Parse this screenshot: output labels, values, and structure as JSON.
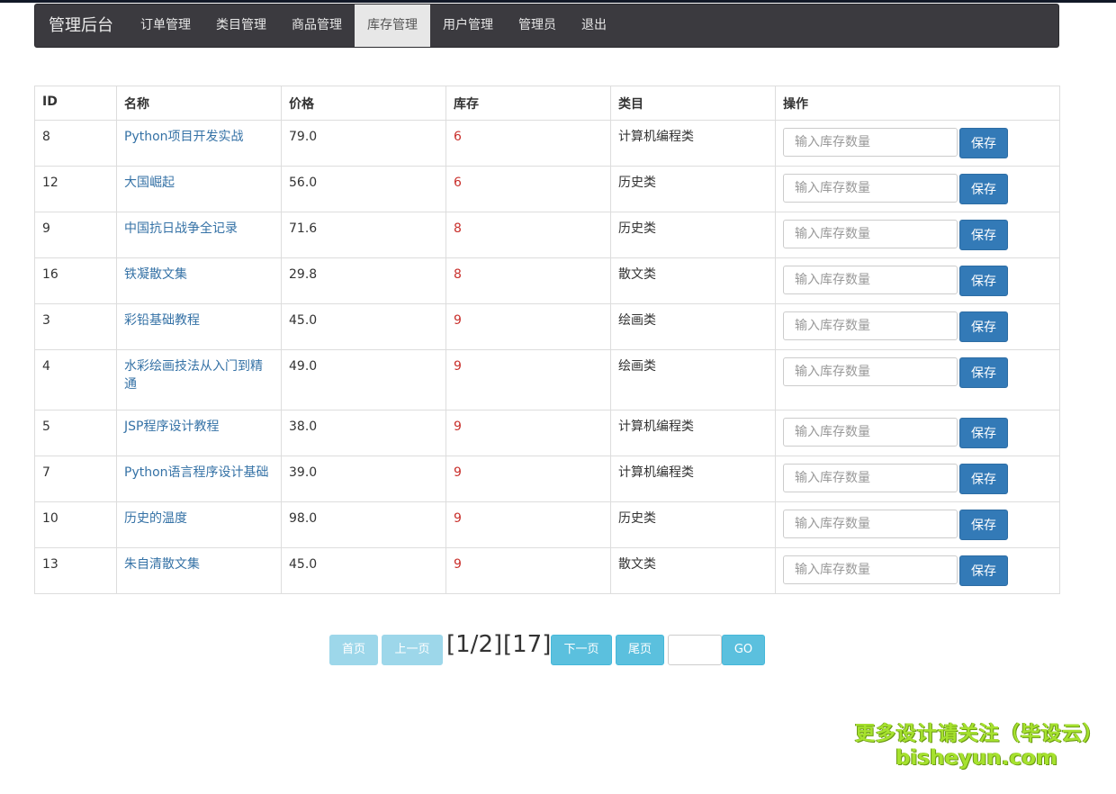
{
  "navbar": {
    "brand": "管理后台",
    "items": [
      {
        "label": "订单管理",
        "active": false
      },
      {
        "label": "类目管理",
        "active": false
      },
      {
        "label": "商品管理",
        "active": false
      },
      {
        "label": "库存管理",
        "active": true
      },
      {
        "label": "用户管理",
        "active": false
      },
      {
        "label": "管理员",
        "active": false
      },
      {
        "label": "退出",
        "active": false
      }
    ]
  },
  "table": {
    "headers": [
      "ID",
      "名称",
      "价格",
      "库存",
      "类目",
      "操作"
    ],
    "input_placeholder": "输入库存数量",
    "save_label": "保存",
    "rows": [
      {
        "id": "8",
        "name": "Python项目开发实战",
        "price": "79.0",
        "stock": "6",
        "category": "计算机编程类"
      },
      {
        "id": "12",
        "name": "大国崛起",
        "price": "56.0",
        "stock": "6",
        "category": "历史类"
      },
      {
        "id": "9",
        "name": "中国抗日战争全记录",
        "price": "71.6",
        "stock": "8",
        "category": "历史类"
      },
      {
        "id": "16",
        "name": "铁凝散文集",
        "price": "29.8",
        "stock": "8",
        "category": "散文类"
      },
      {
        "id": "3",
        "name": "彩铅基础教程",
        "price": "45.0",
        "stock": "9",
        "category": "绘画类"
      },
      {
        "id": "4",
        "name": "水彩绘画技法从入门到精通",
        "price": "49.0",
        "stock": "9",
        "category": "绘画类"
      },
      {
        "id": "5",
        "name": "JSP程序设计教程",
        "price": "38.0",
        "stock": "9",
        "category": "计算机编程类"
      },
      {
        "id": "7",
        "name": "Python语言程序设计基础",
        "price": "39.0",
        "stock": "9",
        "category": "计算机编程类"
      },
      {
        "id": "10",
        "name": "历史的温度",
        "price": "98.0",
        "stock": "9",
        "category": "历史类"
      },
      {
        "id": "13",
        "name": "朱自清散文集",
        "price": "45.0",
        "stock": "9",
        "category": "散文类"
      }
    ]
  },
  "pagination": {
    "first": "首页",
    "prev": "上一页",
    "page_info": "[1/2]",
    "total": "[17]",
    "next": "下一页",
    "last": "尾页",
    "jump_value": "",
    "go": "GO"
  },
  "watermark": {
    "line1": "更多设计请关注（毕设云）",
    "line2": "bisheyun.com"
  },
  "colors": {
    "navbar_bg": "#3b3a3f",
    "link": "#3572a6",
    "stock_text": "#c9302c",
    "primary": "#337ab7",
    "info": "#5bc0de",
    "watermark": "#a6e22e"
  }
}
